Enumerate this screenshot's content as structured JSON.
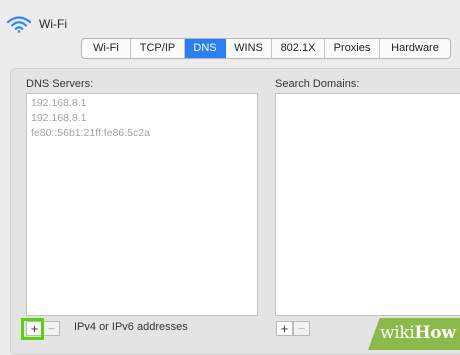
{
  "header": {
    "title": "Wi-Fi",
    "icon": "wifi-icon"
  },
  "tabs": [
    {
      "label": "Wi-Fi",
      "active": false
    },
    {
      "label": "TCP/IP",
      "active": false
    },
    {
      "label": "DNS",
      "active": true
    },
    {
      "label": "WINS",
      "active": false
    },
    {
      "label": "802.1X",
      "active": false
    },
    {
      "label": "Proxies",
      "active": false
    },
    {
      "label": "Hardware",
      "active": false
    }
  ],
  "dns": {
    "label": "DNS Servers:",
    "servers": [
      "192.168.8.1",
      "192.168.8.1",
      "fe80::56b1:21ff:fe86:5c2a"
    ],
    "add_label": "+",
    "remove_label": "−",
    "hint": "IPv4 or IPv6 addresses"
  },
  "search": {
    "label": "Search Domains:",
    "add_label": "+",
    "remove_label": "−"
  },
  "watermark": {
    "part1": "wiki",
    "part2": "How"
  },
  "colors": {
    "accent": "#2a7ff6",
    "highlight": "#55d40c",
    "watermark": "#8cba4a"
  }
}
